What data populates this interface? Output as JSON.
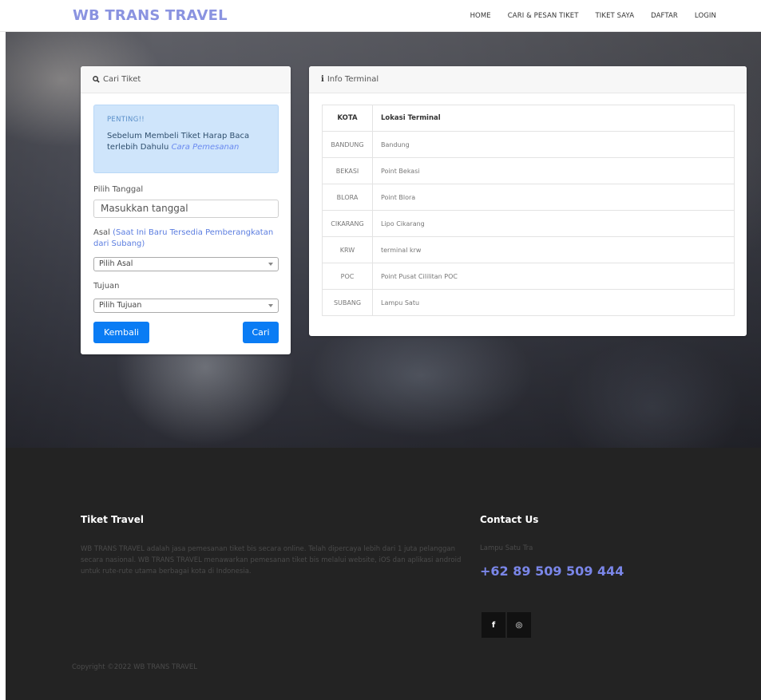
{
  "header": {
    "brand": "WB TRANS TRAVEL",
    "nav": [
      "HOME",
      "CARI & PESAN TIKET",
      "TIKET SAYA",
      "DAFTAR",
      "LOGIN"
    ]
  },
  "search": {
    "title": "Cari Tiket",
    "alert_title": "PENTING!!",
    "alert_text": "Sebelum Membeli Tiket Harap Baca terlebih Dahulu ",
    "alert_link": "Cara Pemesanan",
    "date_label": "Pilih Tanggal",
    "date_placeholder": "Masukkan tanggal",
    "origin_label": "Asal ",
    "origin_note": "(Saat Ini Baru Tersedia Pemberangkatan dari Subang)",
    "origin_select": "Pilih Asal",
    "dest_label": "Tujuan",
    "dest_select": "Pilih Tujuan",
    "back_button": "Kembali",
    "search_button": "Cari"
  },
  "info": {
    "title": "Info Terminal",
    "columns": [
      "KOTA",
      "Lokasi Terminal"
    ],
    "rows": [
      [
        "BANDUNG",
        "Bandung"
      ],
      [
        "BEKASI",
        "Point Bekasi"
      ],
      [
        "BLORA",
        "Point Blora"
      ],
      [
        "CIKARANG",
        "Lipo Cikarang"
      ],
      [
        "KRW",
        "terminal krw"
      ],
      [
        "POC",
        "Point Pusat Cililitan POC"
      ],
      [
        "SUBANG",
        "Lampu Satu"
      ]
    ]
  },
  "footer": {
    "about_title": "Tiket Travel",
    "about_text": "WB TRANS TRAVEL adalah jasa pemesanan tiket bis secara online. Telah dipercaya lebih dari 1 juta pelanggan secara nasional. WB TRANS TRAVEL menawarkan pemesanan tiket bis melalui website, iOS dan aplikasi android untuk rute-rute utama berbagai kota di Indonesia.",
    "contact_title": "Contact Us",
    "address": "Lampu Satu Tra",
    "phone": "+62 89 509 509 444",
    "social": [
      "f",
      "◎"
    ],
    "copyright": "Copyright ©2022 WB TRANS TRAVEL"
  },
  "colors": {
    "brand": "#8a93e0",
    "primary_button": "#0a7cf4",
    "alert_bg": "#cfe5fb",
    "footer_bg": "#232323",
    "phone": "#7a86e8"
  }
}
